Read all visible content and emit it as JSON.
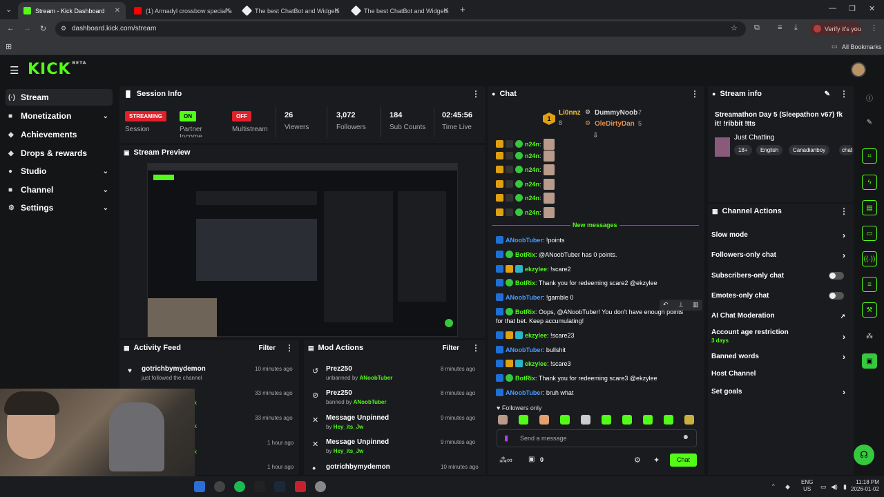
{
  "browser": {
    "tabs": [
      {
        "title": "Stream - Kick Dashboard",
        "color": "#53fc18"
      },
      {
        "title": "(1) Armadyl crossbow special a",
        "color": "#ff0000"
      },
      {
        "title": "The best ChatBot and Widgets",
        "color": "#eeeeee"
      },
      {
        "title": "The best ChatBot and Widgets",
        "color": "#eeeeee"
      }
    ],
    "url": "dashboard.kick.com/stream",
    "verify_label": "Verify it's you",
    "bookmarks_label": "All Bookmarks"
  },
  "header": {
    "logo": "KICK",
    "logo_beta": "BETA"
  },
  "sidebar": {
    "items": [
      {
        "label": "Stream",
        "icon": "(·)"
      },
      {
        "label": "Monetization",
        "icon": "■"
      },
      {
        "label": "Achievements",
        "icon": "◆"
      },
      {
        "label": "Drops & rewards",
        "icon": "◆"
      },
      {
        "label": "Studio",
        "icon": "●"
      },
      {
        "label": "Channel",
        "icon": "■"
      },
      {
        "label": "Settings",
        "icon": "⚙"
      }
    ]
  },
  "session": {
    "title": "Session Info",
    "streaming": "STREAMING",
    "session_label": "Session",
    "on": "ON",
    "partner_label": "Partner Income",
    "off": "OFF",
    "multistream_label": "Multistream",
    "viewers": "26",
    "viewers_label": "Viewers",
    "followers": "3,072",
    "followers_label": "Followers",
    "subs": "184",
    "subs_label": "Sub Counts",
    "time": "02:45:56",
    "time_label": "Time Live"
  },
  "preview": {
    "title": "Stream Preview"
  },
  "activity": {
    "title": "Activity Feed",
    "filter": "Filter",
    "items": [
      {
        "name": "gotrichbymydemon",
        "sub": "just followed the channel",
        "time": "10 minutes ago"
      },
      {
        "name": "",
        "sub": "k",
        "time": "33 minutes ago"
      },
      {
        "name": "",
        "sub": "k",
        "time": "33 minutes ago"
      },
      {
        "name": "",
        "sub": "k",
        "time": "1 hour ago"
      },
      {
        "name": "",
        "sub": "",
        "time": "1 hour ago"
      }
    ]
  },
  "mod": {
    "title": "Mod Actions",
    "filter": "Filter",
    "items": [
      {
        "name": "Prez250",
        "action": "unbanned by",
        "by": "ANoobTuber",
        "time": "8 minutes ago",
        "icon": "↺"
      },
      {
        "name": "Prez250",
        "action": "banned by",
        "by": "ANoobTuber",
        "time": "8 minutes ago",
        "icon": "⊘"
      },
      {
        "name": "Message Unpinned",
        "action": "by",
        "by": "Hey_its_Jw",
        "time": "9 minutes ago",
        "icon": "✕"
      },
      {
        "name": "Message Unpinned",
        "action": "by",
        "by": "Hey_its_Jw",
        "time": "9 minutes ago",
        "icon": "✕"
      },
      {
        "name": "gotrichbymydemon",
        "action": "",
        "by": "",
        "time": "10 minutes ago",
        "icon": "●"
      }
    ]
  },
  "chat": {
    "title": "Chat",
    "top": [
      {
        "name": "Li0nnz",
        "count": "8",
        "rank": "1"
      },
      {
        "name": "DummyNoob",
        "count": "7"
      },
      {
        "name": "OleDirtyDan",
        "count": "5"
      }
    ],
    "repeat_user": "n24n",
    "new_messages": "New messages",
    "messages": [
      {
        "user": "ANoobTuber",
        "color": "blue",
        "text": " !points",
        "badges": [
          "blue"
        ]
      },
      {
        "user": "BotRix",
        "color": "green",
        "text": " @ANoobTuber has 0 points.",
        "badges": [
          "blue",
          "green"
        ]
      },
      {
        "user": "ekzylee",
        "color": "green",
        "text": " !scare2",
        "badges": [
          "blue",
          "gold",
          "cyan"
        ]
      },
      {
        "user": "BotRix",
        "color": "green",
        "text": " Thank you for redeeming scare2 @ekzylee",
        "badges": [
          "blue",
          "green"
        ]
      },
      {
        "user": "ANoobTuber",
        "color": "blue",
        "text": " !gamble 0",
        "badges": [
          "blue"
        ]
      },
      {
        "user": "BotRix",
        "color": "green",
        "text": " Oops, @ANoobTuber! You don't have enough points",
        "badges": [
          "blue",
          "green"
        ]
      },
      {
        "user": "",
        "color": "",
        "text": "for that bet. Keep accumulating!",
        "badges": []
      },
      {
        "user": "ekzylee",
        "color": "green",
        "text": " !scare23",
        "badges": [
          "blue",
          "gold",
          "cyan"
        ]
      },
      {
        "user": "ANoobTuber",
        "color": "blue",
        "text": " bullshit",
        "badges": [
          "blue"
        ]
      },
      {
        "user": "ekzylee",
        "color": "green",
        "text": " !scare3",
        "badges": [
          "blue",
          "gold",
          "cyan"
        ]
      },
      {
        "user": "BotRix",
        "color": "green",
        "text": " Thank you for redeeming scare3 @ekzylee",
        "badges": [
          "blue",
          "green"
        ]
      },
      {
        "user": "ANoobTuber",
        "color": "blue",
        "text": " bruh what",
        "badges": [
          "blue"
        ]
      }
    ],
    "followers_only": "Followers only",
    "placeholder": "Send a message",
    "points": "0",
    "send": "Chat"
  },
  "stream_info": {
    "title": "Stream info",
    "stream_title": "Streamathon Day 5 (Sleepathon v67) fk it! !ribbit !tts",
    "category": "Just Chatting",
    "tags": [
      "18+",
      "English",
      "Canadianboy",
      "chat"
    ]
  },
  "channel_actions": {
    "title": "Channel Actions",
    "items": [
      {
        "label": "Slow mode",
        "type": "arrow"
      },
      {
        "label": "Followers-only chat",
        "type": "arrow"
      },
      {
        "label": "Subscribers-only chat",
        "type": "toggle"
      },
      {
        "label": "Emotes-only chat",
        "type": "toggle"
      },
      {
        "label": "AI Chat Moderation",
        "type": "link"
      },
      {
        "label": "Account age restriction",
        "sub": "3 days",
        "type": "arrow"
      },
      {
        "label": "Banned words",
        "type": "arrow"
      },
      {
        "label": "Host Channel",
        "type": "none"
      },
      {
        "label": "Set goals",
        "type": "arrow"
      }
    ]
  },
  "taskbar": {
    "lang": "ENG",
    "region": "US",
    "time": "11:18 PM",
    "date": "2026-01-02"
  }
}
